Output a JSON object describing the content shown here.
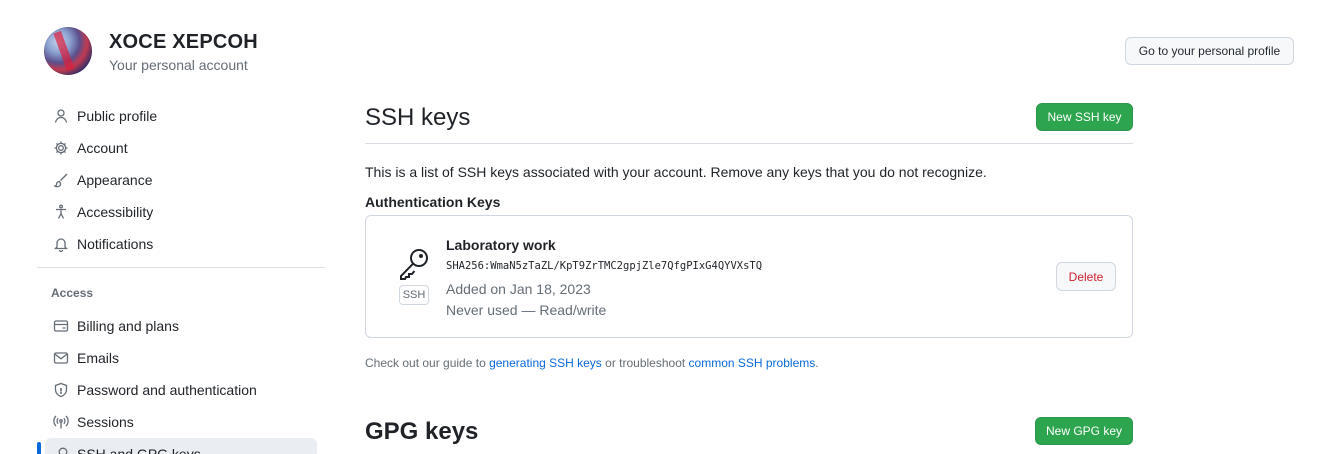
{
  "header": {
    "user_name": "XOCE XEPCOH",
    "subtitle": "Your personal account",
    "profile_button": "Go to your personal profile"
  },
  "sidebar": {
    "items": [
      {
        "label": "Public profile",
        "icon": "person-icon"
      },
      {
        "label": "Account",
        "icon": "gear-icon"
      },
      {
        "label": "Appearance",
        "icon": "paintbrush-icon"
      },
      {
        "label": "Accessibility",
        "icon": "accessibility-icon"
      },
      {
        "label": "Notifications",
        "icon": "bell-icon"
      }
    ],
    "access_group_title": "Access",
    "access_items": [
      {
        "label": "Billing and plans",
        "icon": "credit-card-icon"
      },
      {
        "label": "Emails",
        "icon": "mail-icon"
      },
      {
        "label": "Password and authentication",
        "icon": "shield-icon"
      },
      {
        "label": "Sessions",
        "icon": "broadcast-icon"
      },
      {
        "label": "SSH and GPG keys",
        "icon": "key-icon",
        "active": true
      }
    ]
  },
  "ssh": {
    "title": "SSH keys",
    "new_button": "New SSH key",
    "description": "This is a list of SSH keys associated with your account. Remove any keys that you do not recognize.",
    "auth_title": "Authentication Keys",
    "key": {
      "title": "Laboratory work",
      "fingerprint": "SHA256:WmaN5zTaZL/KpT9ZrTMC2gpjZle7QfgPIxG4QYVXsTQ",
      "added": "Added on Jan 18, 2023",
      "usage": "Never used — Read/write",
      "type_label": "SSH",
      "delete_button": "Delete"
    },
    "guide": {
      "prefix": "Check out our guide to ",
      "link1": "generating SSH keys",
      "middle": " or troubleshoot ",
      "link2": "common SSH problems",
      "suffix": "."
    }
  },
  "gpg": {
    "title": "GPG keys",
    "new_button": "New GPG key"
  },
  "colors": {
    "primary_green": "#2da44e",
    "link_blue": "#0969da",
    "danger_red": "#cf222e",
    "muted_text": "#656d76"
  }
}
